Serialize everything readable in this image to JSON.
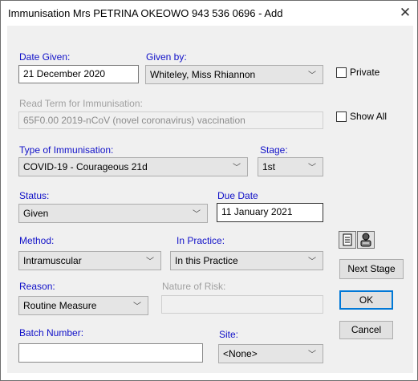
{
  "window": {
    "title": "Immunisation Mrs PETRINA OKEOWO 943 536 0696 - Add",
    "close_glyph": "✕"
  },
  "form": {
    "date_given": {
      "label": "Date Given:",
      "value": "21 December 2020"
    },
    "given_by": {
      "label": "Given by:",
      "value": "Whiteley, Miss Rhiannon"
    },
    "private": {
      "label": "Private",
      "checked": false
    },
    "read_term": {
      "label": "Read Term for Immunisation:",
      "value": "65F0.00 2019-nCoV (novel coronavirus) vaccination"
    },
    "show_all": {
      "label": "Show All",
      "checked": false
    },
    "type_of_immunisation": {
      "label": "Type of Immunisation:",
      "value": "COVID-19 - Courageous 21d"
    },
    "stage": {
      "label": "Stage:",
      "value": "1st"
    },
    "status": {
      "label": "Status:",
      "value": "Given"
    },
    "due_date": {
      "label": "Due Date",
      "value": "11 January 2021"
    },
    "method": {
      "label": "Method:",
      "value": "Intramuscular"
    },
    "in_practice": {
      "label": "In Practice:",
      "value": "In this Practice"
    },
    "reason": {
      "label": "Reason:",
      "value": "Routine Measure"
    },
    "nature_of_risk": {
      "label": "Nature of Risk:",
      "value": ""
    },
    "batch_number": {
      "label": "Batch Number:",
      "value": ""
    },
    "site": {
      "label": "Site:",
      "value": "<None>"
    }
  },
  "buttons": {
    "next_stage": "Next Stage",
    "ok": "OK",
    "cancel": "Cancel"
  },
  "icons": [
    "document-icon",
    "person-lookup-icon",
    "chevron-down-icon",
    "close-icon"
  ],
  "colors": {
    "label_blue": "#1010c8",
    "focus_blue": "#0078d7",
    "panel": "#f0f0f0"
  }
}
